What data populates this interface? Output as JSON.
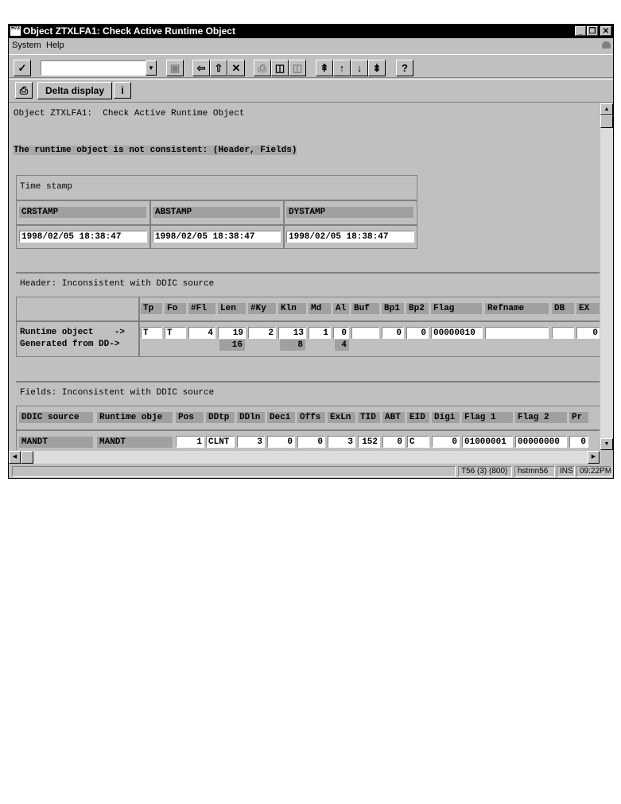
{
  "window": {
    "title": "Object ZTXLFA1:  Check Active Runtime Object",
    "sys_icon_text": "R/3",
    "controls": [
      "_",
      "❐",
      "✕"
    ]
  },
  "menu": {
    "items": [
      "System",
      "Help"
    ]
  },
  "toolbar": {
    "command_field_value": "",
    "buttons": [
      "check-icon",
      "save-icon",
      "back-icon",
      "exit-icon",
      "cancel-icon",
      "print-icon",
      "find-icon",
      "find-next-icon",
      "first-page-icon",
      "previous-page-icon",
      "next-page-icon",
      "last-page-icon",
      "help-icon"
    ]
  },
  "app_toolbar": {
    "delta_label": "Delta display",
    "info_label": "i"
  },
  "content": {
    "heading": "Object ZTXLFA1:  Check Active Runtime Object",
    "message": "The runtime object is not consistent: (Header, Fields)",
    "timestamp": {
      "title": "Time stamp",
      "columns": [
        "CRSTAMP",
        "ABSTAMP",
        "DYSTAMP"
      ],
      "values": [
        "1998/02/05 18:38:47",
        "1998/02/05 18:38:47",
        "1998/02/05 18:38:47"
      ]
    },
    "header_section": {
      "title": "Header: Inconsistent with DDIC source",
      "columns": [
        "Tp",
        "Fo",
        "#Fl",
        "Len",
        "#Ky",
        "Kln",
        "Md",
        "Al",
        "Buf",
        "Bp1",
        "Bp2",
        "Flag",
        "Refname",
        "DB",
        "EX"
      ],
      "row1_label": "Runtime object    ->",
      "row2_label": "Generated from DD->",
      "runtime_values": [
        "T",
        "T",
        "4",
        "19",
        "2",
        "13",
        "1",
        "0",
        "",
        "0",
        "0",
        "00000010",
        "",
        "",
        "0"
      ],
      "generated_values": [
        "",
        "",
        "",
        "16",
        "",
        "8",
        "",
        "4",
        "",
        "",
        "",
        "",
        "",
        "",
        ""
      ]
    },
    "fields_section": {
      "title": "Fields: Inconsistent with DDIC source",
      "columns": [
        "DDIC source",
        "Runtime obje",
        "Pos",
        "DDtp",
        "DDln",
        "Deci",
        "Offs",
        "ExLn",
        "TID",
        "ABT",
        "EID",
        "Digi",
        "Flag 1",
        "Flag 2",
        "Pr"
      ],
      "rows": [
        [
          "MANDT",
          "MANDT",
          "1",
          "CLNT",
          "3",
          "0",
          "0",
          "3",
          "152",
          "0",
          "C",
          "0",
          "01000001",
          "00000000",
          "0"
        ]
      ]
    }
  },
  "status": {
    "message": "",
    "system": "T56 (3) (800)",
    "server": "hstmn56",
    "mode": "INS",
    "time": "09:22PM"
  }
}
